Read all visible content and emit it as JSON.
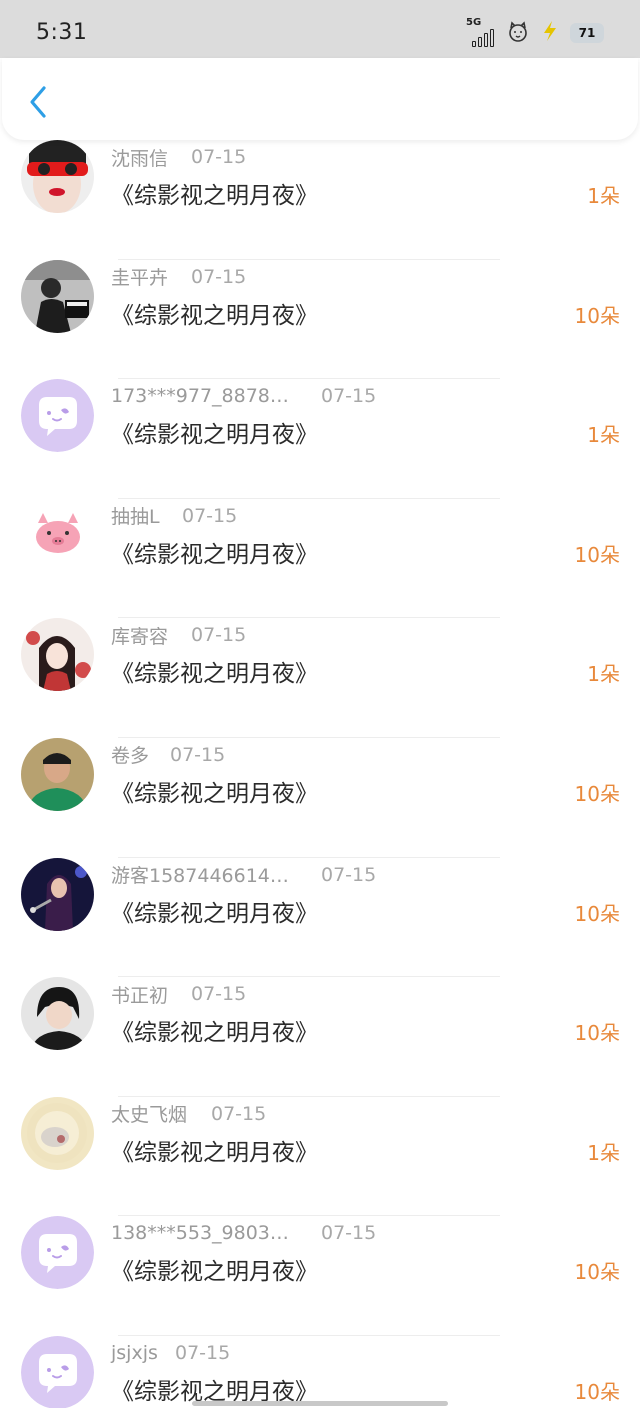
{
  "status_bar": {
    "time": "5:31",
    "network": "5G",
    "battery": "71",
    "icons": [
      "signal-icon",
      "cat-face-icon",
      "lightning-icon",
      "battery-icon"
    ]
  },
  "header": {
    "back_icon": "chevron-left-icon",
    "accent_color": "#2e9fe6"
  },
  "colors": {
    "amount": "#e8893b",
    "name": "#9a9a9a",
    "title": "#2b2b2b",
    "default_avatar_bg": "#d9c9f3"
  },
  "records": [
    {
      "name": "沈雨信",
      "date": "07-15",
      "book": "《综影视之明月夜》",
      "amount": "1朵"
    },
    {
      "name": "圭平卉",
      "date": "07-15",
      "book": "《综影视之明月夜》",
      "amount": "10朵"
    },
    {
      "name": "173***977_8878…",
      "date": "07-15",
      "book": "《综影视之明月夜》",
      "amount": "1朵"
    },
    {
      "name": "抽抽L",
      "date": "07-15",
      "book": "《综影视之明月夜》",
      "amount": "10朵"
    },
    {
      "name": "库寄容",
      "date": "07-15",
      "book": "《综影视之明月夜》",
      "amount": "1朵"
    },
    {
      "name": "卷多",
      "date": "07-15",
      "book": "《综影视之明月夜》",
      "amount": "10朵"
    },
    {
      "name": "游客1587446614…",
      "date": "07-15",
      "book": "《综影视之明月夜》",
      "amount": "10朵"
    },
    {
      "name": "书正初",
      "date": "07-15",
      "book": "《综影视之明月夜》",
      "amount": "10朵"
    },
    {
      "name": "太史飞烟",
      "date": "07-15",
      "book": "《综影视之明月夜》",
      "amount": "1朵"
    },
    {
      "name": "138***553_9803…",
      "date": "07-15",
      "book": "《综影视之明月夜》",
      "amount": "10朵"
    },
    {
      "name": "jsjxjs",
      "date": "07-15",
      "book": "《综影视之明月夜》",
      "amount": "10朵"
    }
  ]
}
